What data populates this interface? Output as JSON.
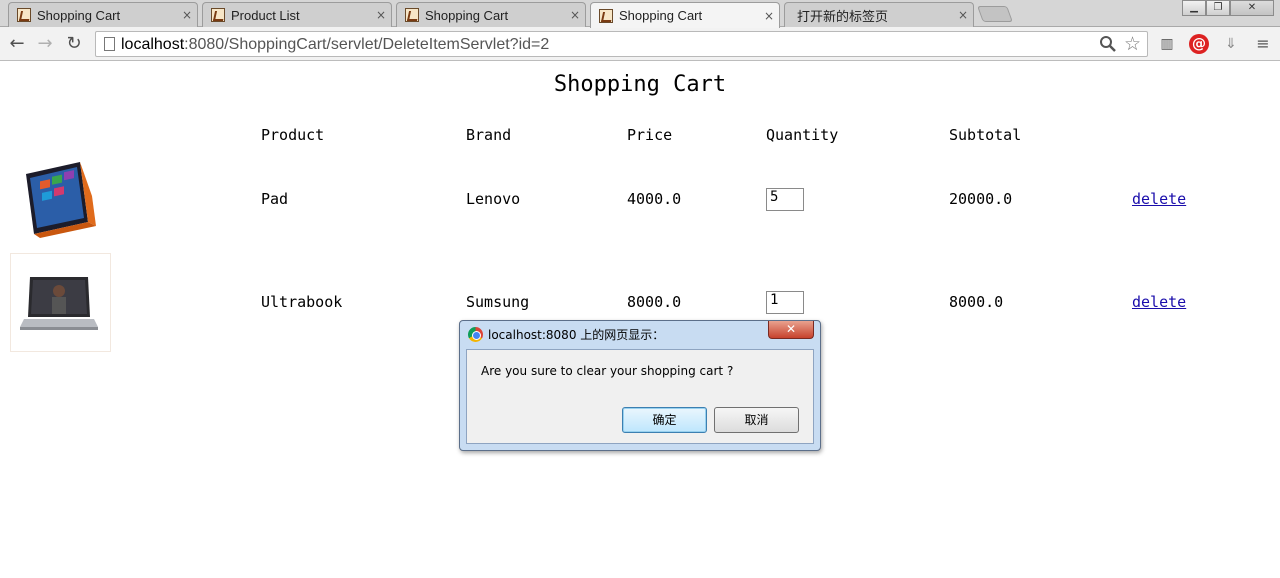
{
  "browser": {
    "tabs": [
      {
        "title": "Shopping Cart",
        "active": false
      },
      {
        "title": "Product List",
        "active": false
      },
      {
        "title": "Shopping Cart",
        "active": false
      },
      {
        "title": "Shopping Cart",
        "active": true
      },
      {
        "title": "打开新的标签页",
        "active": false
      }
    ],
    "close_glyph": "×",
    "url_host": "localhost",
    "url_rest": ":8080/ShoppingCart/servlet/DeleteItemServlet?id=2"
  },
  "page": {
    "title": "Shopping Cart",
    "headers": {
      "product": "Product",
      "brand": "Brand",
      "price": "Price",
      "quantity": "Quantity",
      "subtotal": "Subtotal"
    },
    "rows": [
      {
        "product": "Pad",
        "brand": "Lenovo",
        "price": "4000.0",
        "quantity": "5",
        "subtotal": "20000.0",
        "action": "delete"
      },
      {
        "product": "Ultrabook",
        "brand": "Sumsung",
        "price": "8000.0",
        "quantity": "1",
        "subtotal": "8000.0",
        "action": "delete"
      }
    ]
  },
  "dialog": {
    "title": "localhost:8080 上的网页显示：",
    "message": "Are you sure to clear your shopping cart ?",
    "ok_label": "确定",
    "cancel_label": "取消",
    "close_glyph": "✕"
  }
}
